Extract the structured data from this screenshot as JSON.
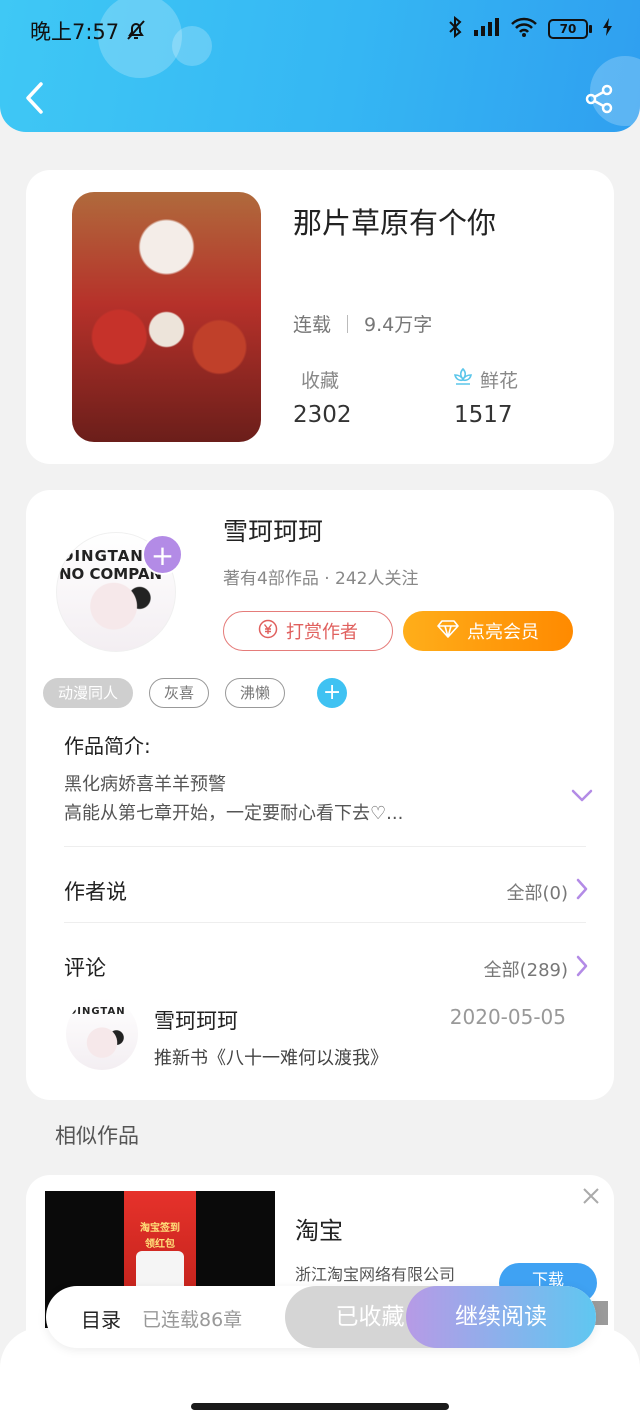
{
  "status_bar": {
    "time": "晚上7:57",
    "battery": "70"
  },
  "book": {
    "title": "那片草原有个你",
    "status": "连载",
    "word_count": "9.4万字",
    "favorites_label": "收藏",
    "favorites_count": "2302",
    "flowers_label": "鲜花",
    "flowers_count": "1517"
  },
  "author": {
    "avatar_text_1": "DINGTAN",
    "avatar_text_2": "NO COMPAN",
    "name": "雪珂珂珂",
    "stats": "著有4部作品 · 242人关注",
    "tip_label": "打赏作者",
    "vip_label": "点亮会员",
    "follow_symbol": "+"
  },
  "tags": {
    "items": [
      "动漫同人",
      "灰喜",
      "沸懒"
    ],
    "add_symbol": "+"
  },
  "intro": {
    "heading": "作品简介:",
    "line1": "黑化病娇喜羊羊预警",
    "line2": "高能从第七章开始，一定要耐心看下去♡..."
  },
  "author_says": {
    "title": "作者说",
    "link": "全部(0)"
  },
  "comments": {
    "title": "评论",
    "link": "全部(289)",
    "first": {
      "user": "雪珂珂珂",
      "date": "2020-05-05",
      "text": "推新书《八十一难何以渡我》"
    }
  },
  "similar": {
    "title": "相似作品"
  },
  "ad": {
    "title": "淘宝",
    "company": "浙江淘宝网络有限公司",
    "download_label": "下载",
    "poster_line1": "淘宝签到",
    "poster_line2": "领红包"
  },
  "bottom_bar": {
    "toc_label": "目录",
    "chapter_count": "已连载86章",
    "collected_label": "已收藏",
    "read_label": "继续阅读"
  },
  "colors": {
    "header_blue": "#35b6f3",
    "accent_purple": "#b38be6",
    "vip_orange": "#ff8a00",
    "tip_red": "#e0605e"
  }
}
